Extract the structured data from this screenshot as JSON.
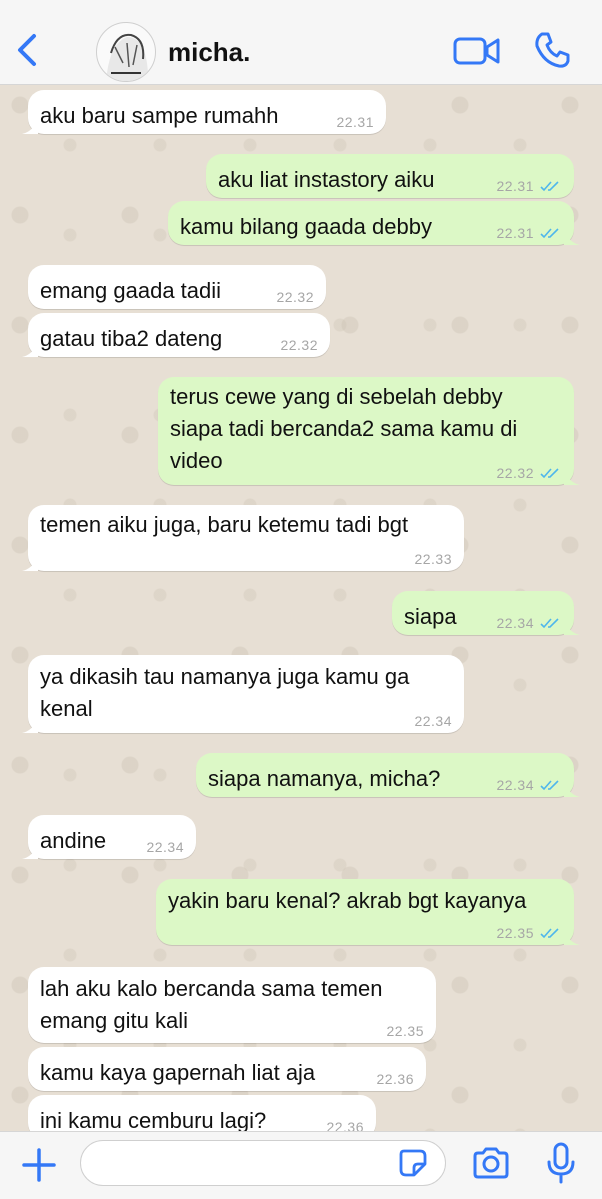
{
  "header": {
    "contact_name": "micha.",
    "back_icon": "chevron-left-icon",
    "video_icon": "video-call-icon",
    "phone_icon": "phone-icon",
    "accent_color": "#3478f6"
  },
  "messages": [
    {
      "dir": "in",
      "text": "aku baru sampe rumahh",
      "time": "22.31"
    },
    {
      "dir": "out",
      "text": "aku liat instastory aiku",
      "time": "22.31",
      "status": "read"
    },
    {
      "dir": "out",
      "text": "kamu bilang gaada debby",
      "time": "22.31",
      "status": "read"
    },
    {
      "dir": "in",
      "text": "emang gaada tadii",
      "time": "22.32"
    },
    {
      "dir": "in",
      "text": "gatau tiba2 dateng",
      "time": "22.32"
    },
    {
      "dir": "out",
      "lines": [
        "terus cewe yang di sebelah debby",
        "siapa tadi bercanda2 sama kamu di",
        "video"
      ],
      "time": "22.32",
      "status": "read"
    },
    {
      "dir": "in",
      "text": "temen aiku juga, baru ketemu tadi bgt",
      "time": "22.33"
    },
    {
      "dir": "out",
      "text": "siapa",
      "time": "22.34",
      "status": "read"
    },
    {
      "dir": "in",
      "lines": [
        "ya dikasih tau namanya juga kamu ga",
        "kenal"
      ],
      "time": "22.34"
    },
    {
      "dir": "out",
      "text": "siapa namanya, micha?",
      "time": "22.34",
      "status": "read"
    },
    {
      "dir": "in",
      "text": "andine",
      "time": "22.34"
    },
    {
      "dir": "out",
      "text": "yakin baru kenal? akrab bgt kayanya",
      "time": "22.35",
      "status": "read"
    },
    {
      "dir": "in",
      "lines": [
        "lah aku kalo bercanda sama temen",
        "emang gitu kali"
      ],
      "time": "22.35"
    },
    {
      "dir": "in",
      "text": "kamu kaya gapernah liat aja",
      "time": "22.36"
    },
    {
      "dir": "in",
      "text": "ini kamu cemburu lagi?",
      "time": "22.36"
    }
  ],
  "composer": {
    "input_value": "",
    "plus_icon": "plus-icon",
    "sticker_icon": "sticker-icon",
    "camera_icon": "camera-icon",
    "mic_icon": "microphone-icon"
  },
  "colors": {
    "outgoing_bubble": "#dcf8c6",
    "incoming_bubble": "#ffffff",
    "read_ticks": "#4fb6ec",
    "chat_background": "#e7dfd4"
  }
}
